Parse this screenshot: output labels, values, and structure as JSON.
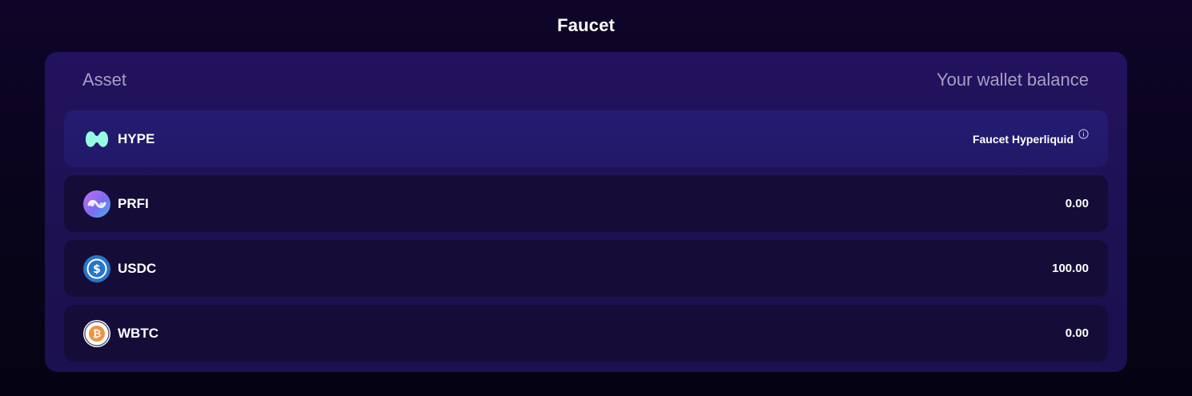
{
  "page": {
    "title": "Faucet"
  },
  "table": {
    "headers": {
      "asset": "Asset",
      "balance": "Your wallet balance"
    },
    "rows": [
      {
        "symbol": "HYPE",
        "icon": "hyperliquid-logo-icon",
        "right_text": "Faucet Hyperliquid",
        "right_icon": "info-icon",
        "highlighted": true
      },
      {
        "symbol": "PRFI",
        "icon": "prfi-logo-icon",
        "right_text": "0.00"
      },
      {
        "symbol": "USDC",
        "icon": "usdc-logo-icon",
        "right_text": "100.00"
      },
      {
        "symbol": "WBTC",
        "icon": "wbtc-logo-icon",
        "right_text": "0.00"
      }
    ]
  },
  "colors": {
    "background": "#0b0420",
    "card": "#1f1157",
    "row": "#150d38",
    "row_highlight": "#231b6e",
    "header_text": "#a69fc4",
    "hype_mint": "#97fce4",
    "usdc_blue": "#2775ca",
    "btc_orange": "#f09242"
  }
}
